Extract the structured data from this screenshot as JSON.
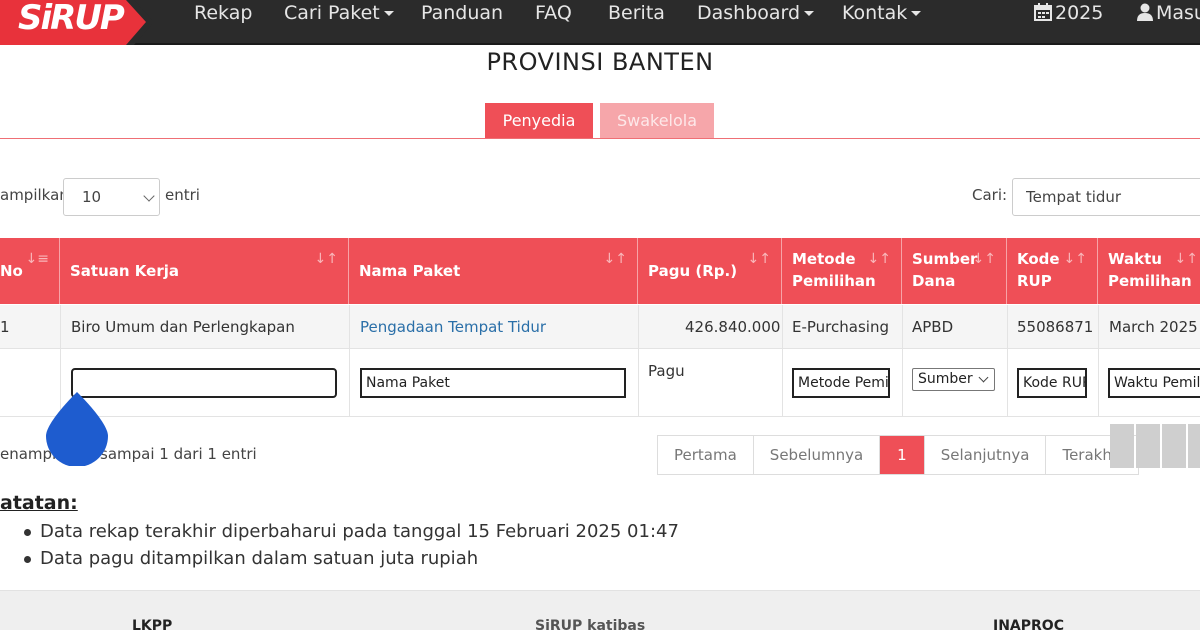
{
  "navbar": {
    "brand": "SiRUP",
    "items": [
      "Rekap",
      "Cari Paket",
      "Panduan",
      "FAQ",
      "Berita",
      "Dashboard",
      "Kontak"
    ],
    "year": "2025",
    "login": "Masuk"
  },
  "page": {
    "title": "PROVINSI BANTEN"
  },
  "tabs": [
    "Penyedia",
    "Swakelola"
  ],
  "controls": {
    "length_prefix": "ampilkan",
    "length_value": "10",
    "length_suffix": "entri",
    "search_label": "Cari:",
    "search_value": "Tempat tidur"
  },
  "table": {
    "headers": [
      "No",
      "Satuan Kerja",
      "Nama Paket",
      "Pagu (Rp.)",
      "Metode Pemilihan",
      "Sumber Dana",
      "Kode RUP",
      "Waktu Pemilihan"
    ],
    "rows": [
      [
        "1",
        "Biro Umum dan Perlengkapan",
        "Pengadaan Tempat Tidur",
        "426.840.000",
        "E-Purchasing",
        "APBD",
        "55086871",
        "March 2025"
      ]
    ],
    "filters": {
      "satuan_kerja": "",
      "nama_paket": "Nama Paket",
      "pagu": "Pagu",
      "metode": "Metode Pemilihan",
      "sumber": "Sumber",
      "kode": "Kode RUP",
      "waktu": "Waktu Pemilihan"
    }
  },
  "info": {
    "left": "enampi",
    "right": "sampai 1 dari 1 entri"
  },
  "pagination": {
    "first": "Pertama",
    "prev": "Sebelumnya",
    "current": "1",
    "next": "Selanjutnya",
    "last": "Terakhir"
  },
  "notes": {
    "title": "atatan:",
    "items": [
      "Data rekap terakhir diperbaharui pada tanggal 15 Februari 2025 01:47",
      "Data pagu ditampilkan dalam satuan juta rupiah"
    ]
  },
  "footer": {
    "logos": [
      "LKPP",
      "SiRUP katibas",
      "INAPROC"
    ]
  },
  "colors": {
    "accent": "#ef4f57",
    "navbar": "#2b2b2b",
    "link": "#2a6fa8",
    "touch_marker": "#1e5ccf"
  }
}
